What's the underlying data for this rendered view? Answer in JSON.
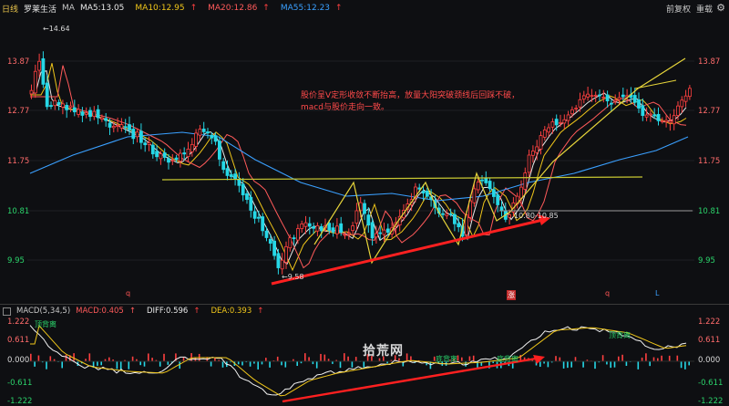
{
  "topbar": {
    "period": "日线",
    "stock": "罗莱生活",
    "ma_label": "MA",
    "ma5": "MA5:13.05",
    "ma10": "MA10:12.95",
    "ma20": "MA20:12.86",
    "ma55": "MA55:12.23",
    "up_arrow": "↑",
    "right_tools": [
      "前复权",
      "重载"
    ],
    "settings_icon": "gear-icon"
  },
  "price_axis": {
    "left": [
      "13.87",
      "12.77",
      "11.75",
      "10.81",
      "9.95"
    ],
    "right": [
      "13.87",
      "12.77",
      "11.75",
      "10.81",
      "9.95"
    ]
  },
  "annotations": {
    "high": "14.64",
    "low": "9.58",
    "range": "10.80-10.85",
    "analysis_line1": "股价呈V定形收敛不断抬高，放量大阳突破颈线后回踩不破，",
    "analysis_line2": "macd与股价走向一致。"
  },
  "markers": [
    "q",
    "涨",
    "q",
    "L"
  ],
  "macd_bar": {
    "name": "MACD(5,34,5)",
    "macd": "MACD:0.405",
    "diff": "DIFF:0.596",
    "dea": "DEA:0.393",
    "up_arrow": "↑"
  },
  "macd_axis": {
    "left": [
      "1.222",
      "0.611",
      "0.000",
      "-0.611",
      "-1.222"
    ],
    "right": [
      "1.222",
      "0.611",
      "0.000",
      "-0.611",
      "-1.222"
    ]
  },
  "macd_tags": [
    "顶背离",
    "底背离",
    "底背离",
    "顶背离"
  ],
  "watermark": "拾荒网",
  "colors": {
    "up": "#ff4040",
    "down": "#26d7e6",
    "ma5": "#e8e8e8",
    "ma10": "#f0c61a",
    "ma20": "#ff5a5a",
    "ma55": "#3aa0ff",
    "neckline": "#c8c832",
    "trend": "#ff2020"
  }
}
